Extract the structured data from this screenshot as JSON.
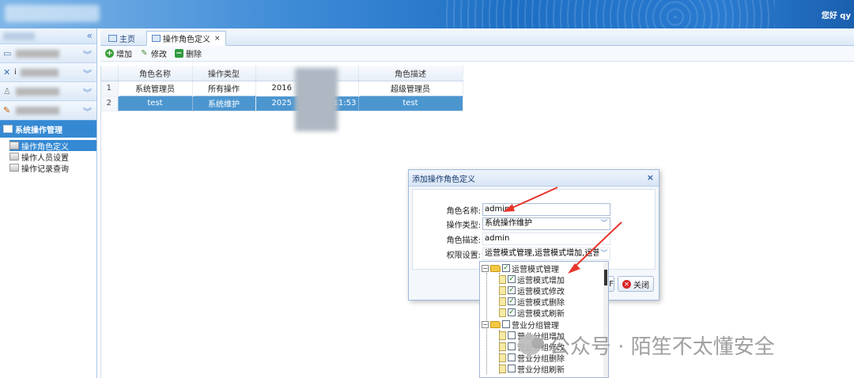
{
  "header": {
    "greeting": "您好 qy"
  },
  "sidebar": {
    "collapse_icon": "«",
    "groups": [
      {
        "icon": "folder-icon",
        "label": ""
      },
      {
        "icon": "tools-icon",
        "label": "i"
      },
      {
        "icon": "user-icon",
        "label": ""
      },
      {
        "icon": "edit-icon",
        "label": ""
      }
    ],
    "active_group": "系统操作管理",
    "items": [
      "操作角色定义",
      "操作人员设置",
      "操作记录查询"
    ]
  },
  "tabs": {
    "home": "主页",
    "active": "操作角色定义",
    "close": "×"
  },
  "toolbar": {
    "add": "增加",
    "edit": "修改",
    "delete": "删除"
  },
  "table": {
    "columns": [
      "角色名称",
      "操作类型",
      "",
      "角色描述"
    ],
    "rows": [
      {
        "num": "1",
        "name": "系统管理员",
        "type": "所有操作",
        "time": "2016",
        "desc": "超级管理员"
      },
      {
        "num": "2",
        "name": "test",
        "type": "系统维护",
        "time": "2025",
        "time_end": "11:53",
        "desc": "test"
      }
    ]
  },
  "dialog": {
    "title": "添加操作角色定义",
    "close": "×",
    "fields": {
      "name_label": "角色名称:",
      "name_value": "admin",
      "type_label": "操作类型:",
      "type_value": "系统操作维护",
      "desc_label": "角色描述:",
      "desc_value": "admin",
      "perm_label": "权限设置:",
      "perm_value": "运营模式管理,运营模式增加,运营模"
    },
    "close_button": "关闭",
    "hidden_button_tail": "F"
  },
  "tree": {
    "nodes": [
      {
        "label": "运营模式管理",
        "level": 0,
        "checked": true,
        "folder": true
      },
      {
        "label": "运营模式增加",
        "level": 1,
        "checked": true
      },
      {
        "label": "运营模式修改",
        "level": 1,
        "checked": true
      },
      {
        "label": "运营模式删除",
        "level": 1,
        "checked": true
      },
      {
        "label": "运营模式刷新",
        "level": 1,
        "checked": true
      },
      {
        "label": "营业分组管理",
        "level": 0,
        "checked": false,
        "folder": true
      },
      {
        "label": "营业分组增加",
        "level": 1,
        "checked": false
      },
      {
        "label": "营业分组修改",
        "level": 1,
        "checked": false
      },
      {
        "label": "营业分组删除",
        "level": 1,
        "checked": false
      },
      {
        "label": "营业分组刷新",
        "level": 1,
        "checked": false
      }
    ]
  },
  "watermark": {
    "text": "公众号 · 陌笙不太懂安全"
  },
  "colors": {
    "accent": "#3589d3",
    "selected_row": "#4c96d0",
    "arrow": "#e8352b"
  }
}
